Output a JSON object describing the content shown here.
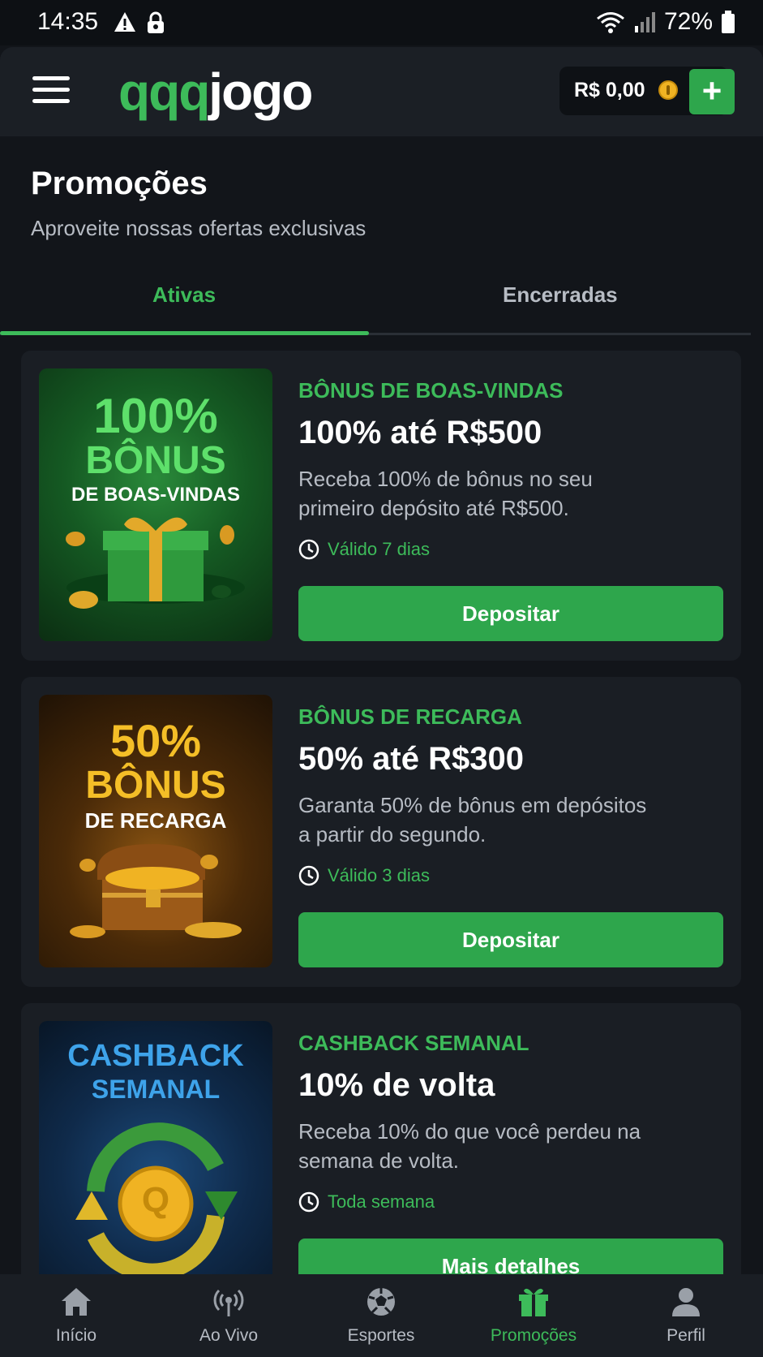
{
  "status_bar": {
    "time": "14:35",
    "battery": "72%"
  },
  "header": {
    "logo_green": "qqq",
    "logo_white": "jogo",
    "balance": "R$ 0,00",
    "add_label": "+"
  },
  "page": {
    "title": "Promoções",
    "subtitle": "Aproveite nossas ofertas exclusivas"
  },
  "tabs": [
    {
      "label": "Ativas",
      "active": true
    },
    {
      "label": "Encerradas",
      "active": false
    }
  ],
  "promos": [
    {
      "banner_line1": "100%",
      "banner_line2": "BÔNUS",
      "banner_line3": "DE BOAS-VINDAS",
      "type": "BÔNUS DE BOAS-VINDAS",
      "headline": "100% até R$500",
      "description": "Receba 100% de bônus no seu primeiro depósito até R$500.",
      "validity": "Válido 7 dias",
      "cta": "Depositar"
    },
    {
      "banner_line1": "50%",
      "banner_line2": "BÔNUS",
      "banner_line3": "DE RECARGA",
      "type": "BÔNUS DE RECARGA",
      "headline": "50% até R$300",
      "description": "Garanta 50% de bônus em depósitos a partir do segundo.",
      "validity": "Válido 3 dias",
      "cta": "Depositar"
    },
    {
      "banner_line1": "CASHBACK",
      "banner_line2": "SEMANAL",
      "banner_coin": "Q",
      "type": "CASHBACK SEMANAL",
      "headline": "10% de volta",
      "description": "Receba 10% do que você perdeu na semana de volta.",
      "validity": "Toda semana",
      "cta": "Mais detalhes"
    }
  ],
  "bottom_nav": [
    {
      "label": "Início",
      "icon": "home-icon"
    },
    {
      "label": "Ao Vivo",
      "icon": "live-icon"
    },
    {
      "label": "Esportes",
      "icon": "soccer-ball-icon"
    },
    {
      "label": "Promoções",
      "icon": "gift-icon",
      "active": true
    },
    {
      "label": "Perfil",
      "icon": "user-icon"
    }
  ],
  "colors": {
    "accent": "#3dbb5a",
    "button": "#2ea64c",
    "background": "#12151a",
    "card": "#1a1e24"
  }
}
